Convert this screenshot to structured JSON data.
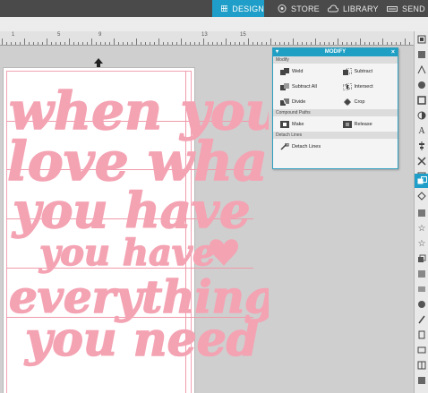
{
  "tabs": [
    {
      "label": "DESIGN",
      "icon": "grid-icon",
      "active": true
    },
    {
      "label": "STORE",
      "icon": "store-icon",
      "active": false
    },
    {
      "label": "LIBRARY",
      "icon": "cloud-icon",
      "active": false
    },
    {
      "label": "SEND",
      "icon": "cutter-icon",
      "active": false
    }
  ],
  "ruler": {
    "labels": [
      "1",
      "5",
      "9",
      "13",
      "15"
    ]
  },
  "modify_panel": {
    "title": "MODIFY",
    "sections": [
      {
        "name": "Modify",
        "buttons": [
          "Weld",
          "Subtract",
          "Subtract All",
          "Intersect",
          "Divide",
          "Crop"
        ]
      },
      {
        "name": "Compound Paths",
        "buttons": [
          "Make",
          "Release"
        ]
      },
      {
        "name": "Detach Lines",
        "buttons": [
          "Detach Lines"
        ]
      }
    ]
  },
  "artwork": {
    "lines": [
      "when you",
      "love what",
      "you have",
      "you have",
      "everything",
      "you need"
    ],
    "color": "#f4a3b3"
  },
  "colors": {
    "accent": "#1e9ec8",
    "topbar": "#4a4a4a",
    "pink": "#f4a3b3"
  }
}
